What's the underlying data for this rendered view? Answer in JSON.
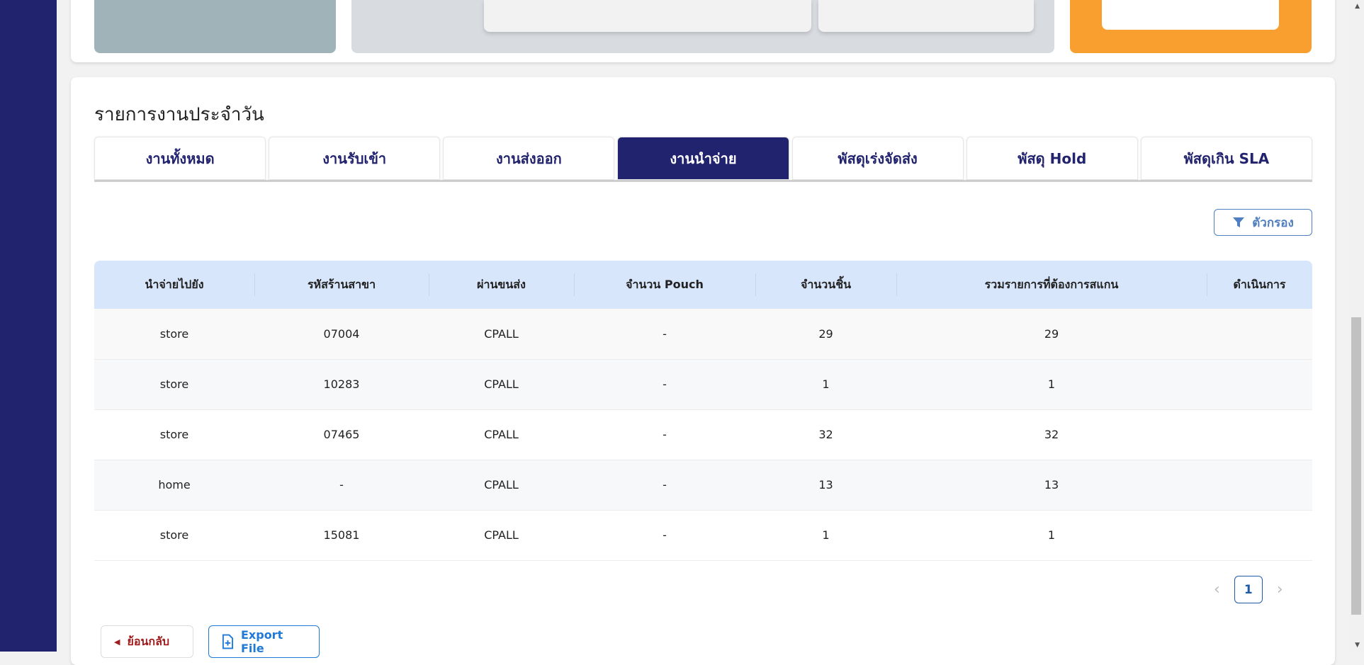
{
  "section_title": "รายการงานประจำวัน",
  "tabs": [
    {
      "label": "งานทั้งหมด"
    },
    {
      "label": "งานรับเข้า"
    },
    {
      "label": "งานส่งออก"
    },
    {
      "label": "งานนำจ่าย"
    },
    {
      "label": "พัสดุเร่งจัดส่ง"
    },
    {
      "label": "พัสดุ Hold"
    },
    {
      "label": "พัสดุเกิน SLA"
    }
  ],
  "active_tab": "งานนำจ่าย",
  "filter_label": "ตัวกรอง",
  "table": {
    "headers": [
      "นำจ่ายไปยัง",
      "รหัสร้านสาขา",
      "ผ่านขนส่ง",
      "จำนวน Pouch",
      "จำนวนชิ้น",
      "รวมรายการที่ต้องการสแกน",
      "ดำเนินการ"
    ],
    "rows": [
      [
        "store",
        "07004",
        "CPALL",
        "-",
        "29",
        "29",
        ""
      ],
      [
        "store",
        "10283",
        "CPALL",
        "-",
        "1",
        "1",
        ""
      ],
      [
        "store",
        "07465",
        "CPALL",
        "-",
        "32",
        "32",
        ""
      ],
      [
        "home",
        "-",
        "CPALL",
        "-",
        "13",
        "13",
        ""
      ],
      [
        "store",
        "15081",
        "CPALL",
        "-",
        "1",
        "1",
        ""
      ]
    ]
  },
  "pagination": {
    "current": "1"
  },
  "back_label": "ย้อนกลับ",
  "export_label": "Export File",
  "colors": {
    "primary": "#22236e",
    "header_bg": "#d8e6fb",
    "accent_orange": "#f99f2f"
  }
}
